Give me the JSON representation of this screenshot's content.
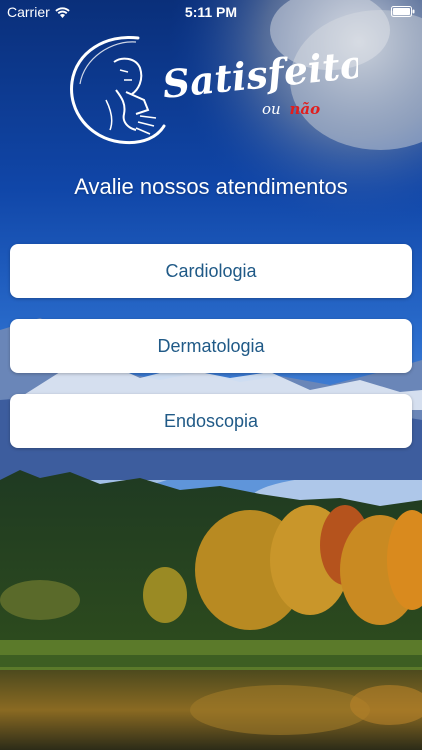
{
  "status_bar": {
    "carrier": "Carrier",
    "time": "5:11 PM"
  },
  "logo": {
    "title": "Satisfeito?",
    "subtitle_prefix": "ou",
    "subtitle_accent": "não"
  },
  "heading": "Avalie nossos atendimentos",
  "menu": {
    "items": [
      {
        "label": "Cardiologia"
      },
      {
        "label": "Dermatologia"
      },
      {
        "label": "Endoscopia"
      }
    ]
  },
  "colors": {
    "button_text": "#205a87",
    "button_bg": "#ffffff",
    "logo_accent": "#e01e1e"
  }
}
